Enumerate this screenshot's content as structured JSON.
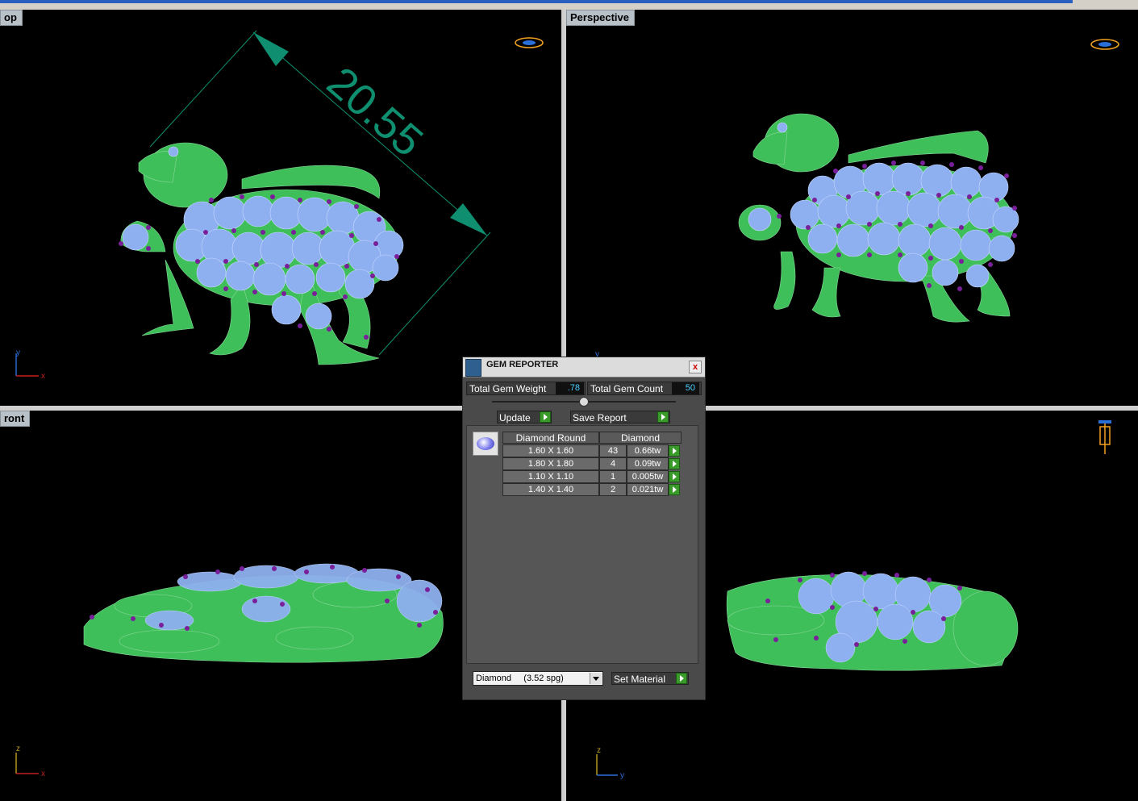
{
  "viewports": {
    "top": {
      "label": "op",
      "dimension": "20.55",
      "axis_x": "x",
      "axis_y": "y"
    },
    "perspective": {
      "label": "Perspective",
      "axis_y": "y"
    },
    "front": {
      "label": "ront",
      "axis_x": "x",
      "axis_z": "z"
    },
    "right": {
      "axis_y": "y",
      "axis_z": "z"
    }
  },
  "gem_reporter": {
    "title": "GEM REPORTER",
    "close": "x",
    "total_weight_label": "Total Gem Weight",
    "total_weight_value": ".78",
    "total_count_label": "Total Gem Count",
    "total_count_value": "50",
    "update_label": "Update",
    "save_report_label": "Save Report",
    "columns": {
      "shape": "Diamond Round",
      "material": "Diamond"
    },
    "rows": [
      {
        "size": "1.60 X 1.60",
        "count": "43",
        "weight": "0.66tw"
      },
      {
        "size": "1.80 X 1.80",
        "count": "4",
        "weight": "0.09tw"
      },
      {
        "size": "1.10 X 1.10",
        "count": "1",
        "weight": "0.005tw"
      },
      {
        "size": "1.40 X 1.40",
        "count": "2",
        "weight": "0.021tw"
      }
    ],
    "material_select": "Diamond     (3.52 spg)",
    "set_material_label": "Set Material"
  },
  "colors": {
    "metal": "#3fbf5a",
    "gem": "#8fb0f0",
    "prong": "#7a1f9a",
    "dimension": "#0f8f6f",
    "accent_green": "#3a9a2a"
  }
}
